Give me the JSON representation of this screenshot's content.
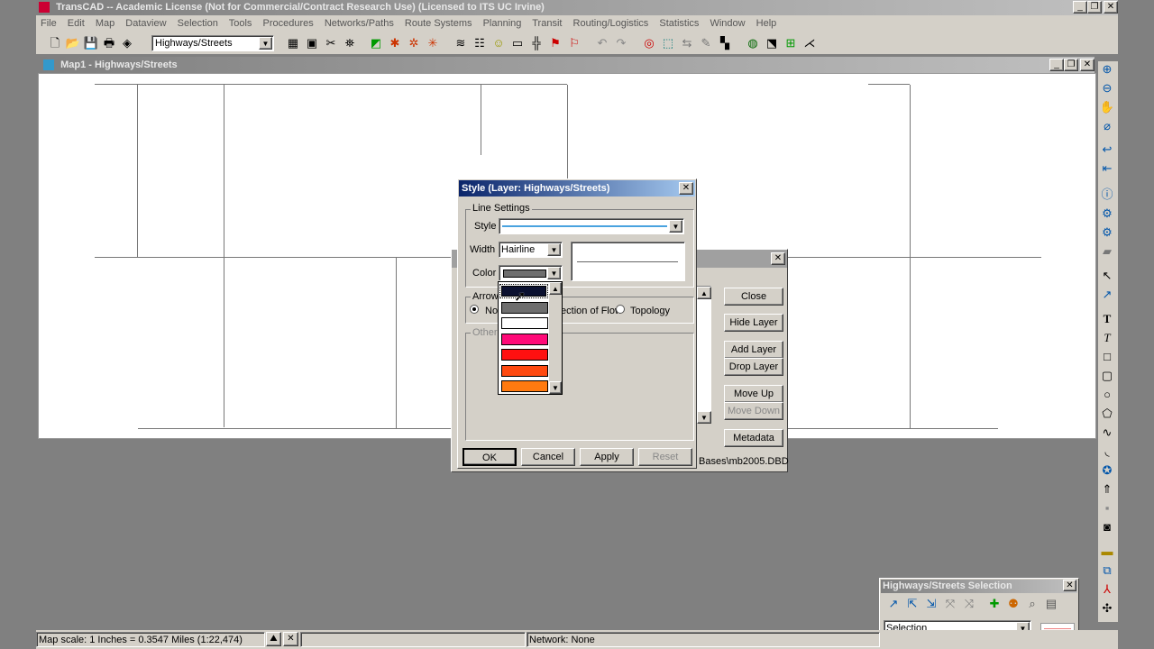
{
  "app": {
    "title": "TransCAD -- Academic License (Not for Commercial/Contract Research Use) (Licensed to ITS UC Irvine)"
  },
  "menu": [
    "File",
    "Edit",
    "Map",
    "Dataview",
    "Selection",
    "Tools",
    "Procedures",
    "Networks/Paths",
    "Route Systems",
    "Planning",
    "Transit",
    "Routing/Logistics",
    "Statistics",
    "Window",
    "Help"
  ],
  "toolbar": {
    "layer_select": "Highways/Streets"
  },
  "map_window": {
    "title": "Map1 - Highways/Streets"
  },
  "layers_dialog": {
    "close": "Close",
    "hide_layer": "Hide Layer",
    "add_layer": "Add Layer",
    "drop_layer": "Drop Layer",
    "move_up": "Move Up",
    "move_down": "Move Down",
    "metadata": "Metadata",
    "path": "Bases\\mb2005.DBD"
  },
  "style_dialog": {
    "title": "Style (Layer: Highways/Streets)",
    "line_settings": "Line Settings",
    "style_label": "Style",
    "width_label": "Width",
    "width_value": "Hairline",
    "color_label": "Color",
    "arrows_label": "Arrows",
    "arrow_none": "None",
    "arrow_flow": "Direction of Flow",
    "arrow_topology": "Topology",
    "other_label": "Other",
    "ok": "OK",
    "cancel": "Cancel",
    "apply": "Apply",
    "reset": "Reset",
    "color_options": [
      "#0a1030",
      "#6e6e6e",
      "#ffffff",
      "#ff0a78",
      "#ff1010",
      "#ff4a10",
      "#ff7a10"
    ]
  },
  "selection_toolbar": {
    "title": "Highways/Streets Selection",
    "set_value": "Selection"
  },
  "status_bar": {
    "scale": "Map scale: 1 Inches = 0.3547 Miles (1:22,474)",
    "network": "Network: None"
  }
}
